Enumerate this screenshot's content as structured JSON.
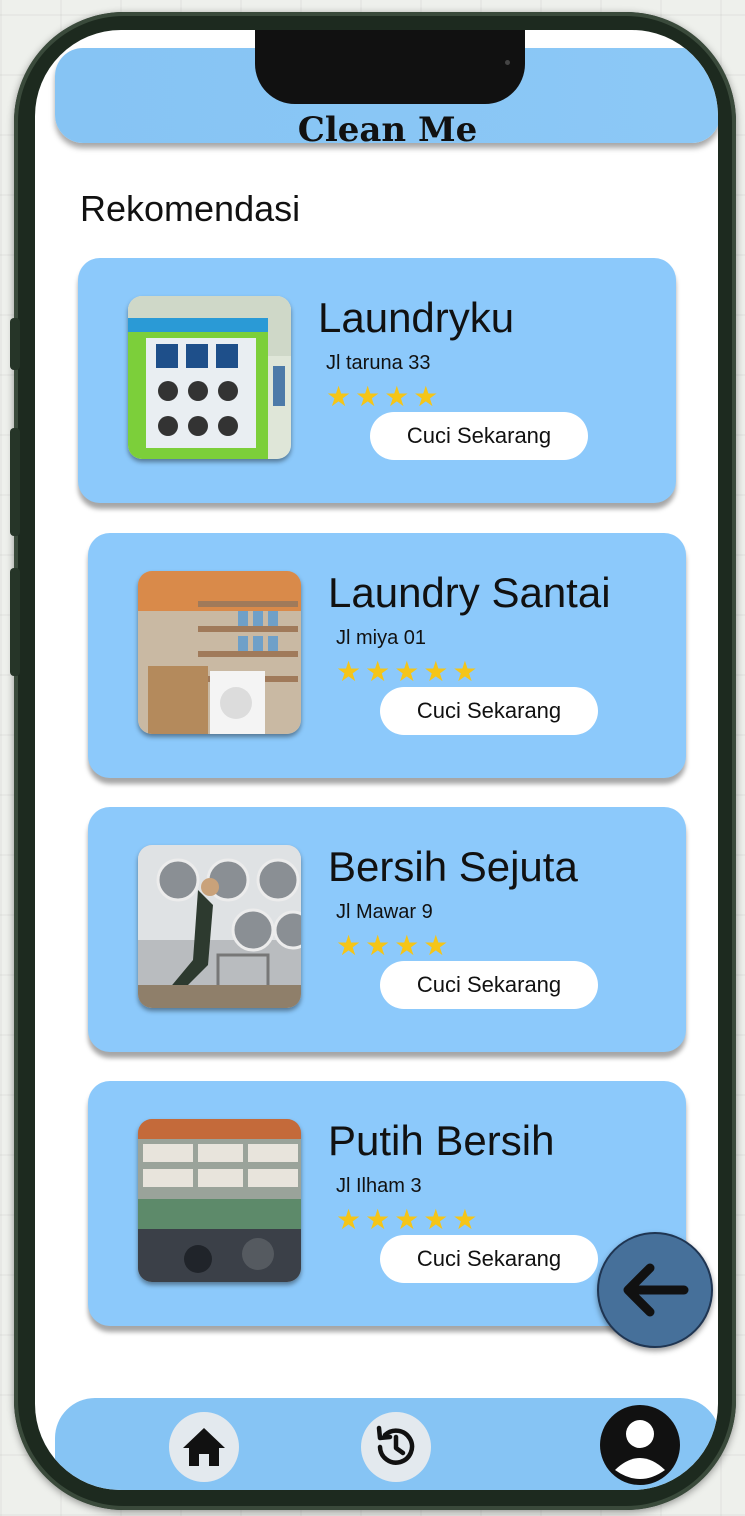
{
  "app": {
    "title": "Clean Me"
  },
  "section": {
    "title": "Rekomendasi"
  },
  "recommendations": [
    {
      "name": "Laundryku",
      "address": "Jl taruna 33",
      "stars": "★★★★",
      "rating": 4,
      "cta_label": "Cuci Sekarang"
    },
    {
      "name": "Laundry Santai",
      "address": "Jl miya 01",
      "stars": "★★★★★",
      "rating": 5,
      "cta_label": "Cuci Sekarang"
    },
    {
      "name": "Bersih Sejuta",
      "address": "Jl Mawar 9",
      "stars": "★★★★",
      "rating": 4,
      "cta_label": "Cuci Sekarang"
    },
    {
      "name": "Putih Bersih",
      "address": "Jl Ilham 3",
      "stars": "★★★★★",
      "rating": 5,
      "cta_label": "Cuci Sekarang"
    }
  ],
  "nav": {
    "icons": [
      "home-icon",
      "history-icon",
      "profile-icon"
    ]
  },
  "fab": {
    "icon": "arrow-left-icon"
  },
  "colors": {
    "accent": "#8cc9fb",
    "fab": "#46709a",
    "star": "#f5c518"
  }
}
